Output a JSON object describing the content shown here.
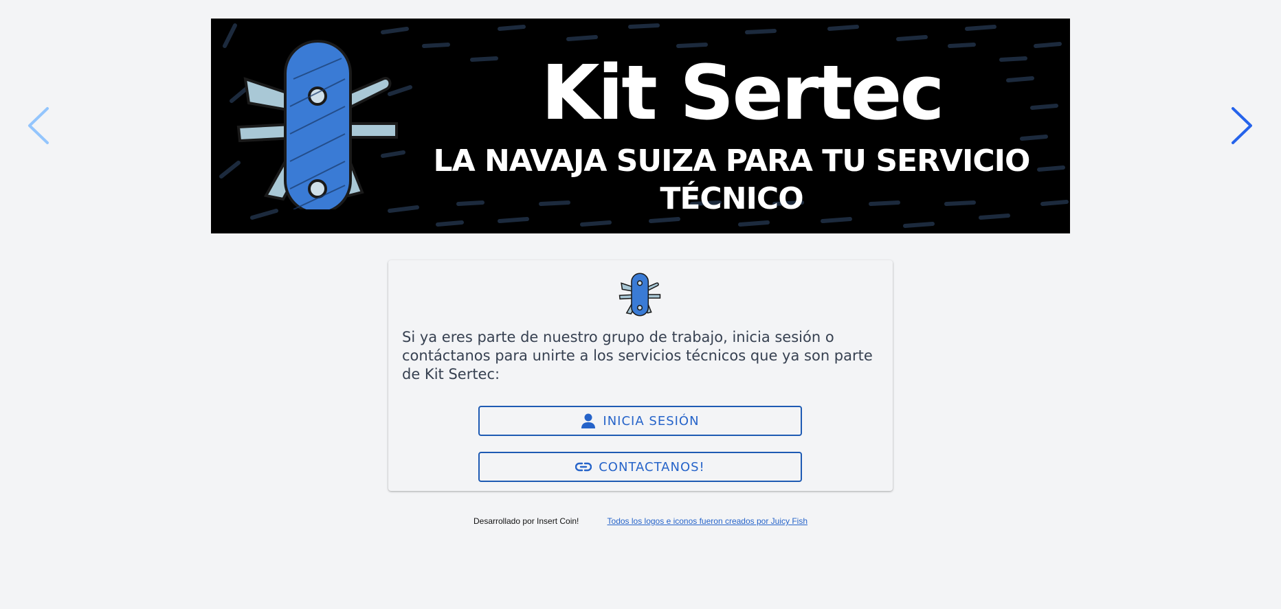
{
  "banner": {
    "title": "Kit Sertec",
    "subtitle": "LA NAVAJA SUIZA PARA TU SERVICIO TÉCNICO",
    "background_color": "#000000",
    "logo_icon": "swiss-knife-icon"
  },
  "carousel": {
    "prev_icon": "chevron-left-icon",
    "next_icon": "chevron-right-icon",
    "prev_color": "#93c5fd",
    "next_color": "#2563eb"
  },
  "card": {
    "logo_icon": "swiss-knife-icon",
    "intro_text": "Si ya eres parte de nuestro grupo de trabajo, inicia sesión o contáctanos para unirte a los servicios técnicos que ya son parte de Kit Sertec:",
    "login_button": {
      "label": "INICIA SESIÓN",
      "icon": "user-icon"
    },
    "contact_button": {
      "label": "CONTACTANOS!",
      "icon": "link-icon"
    }
  },
  "footer": {
    "credit_text": "Desarrollado por Insert Coin!",
    "link_text": "Todos los logos e iconos fueron creados por Juicy Fish"
  },
  "colors": {
    "page_background": "#f3f4f6",
    "accent": "#2563c9",
    "knife_blue": "#3a7bd5"
  }
}
